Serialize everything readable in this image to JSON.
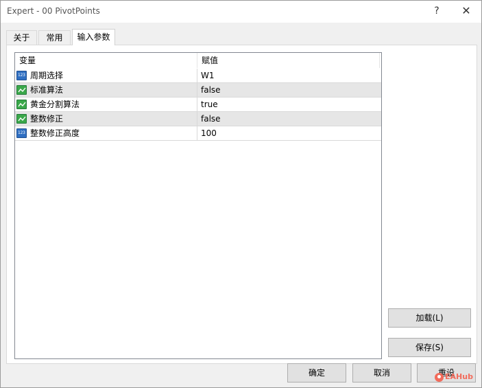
{
  "window": {
    "title": "Expert - 00 PivotPoints",
    "help_glyph": "?",
    "close_glyph": "✕"
  },
  "tabs": [
    {
      "label": "关于",
      "active": false
    },
    {
      "label": "常用",
      "active": false
    },
    {
      "label": "输入参数",
      "active": true
    }
  ],
  "grid": {
    "headers": [
      "变量",
      "赋值"
    ],
    "rows": [
      {
        "name": "周期选择",
        "value": "W1",
        "icon": "number-icon"
      },
      {
        "name": "标准算法",
        "value": "false",
        "icon": "boolean-icon"
      },
      {
        "name": "黄金分割算法",
        "value": "true",
        "icon": "boolean-icon"
      },
      {
        "name": "整数修正",
        "value": "false",
        "icon": "boolean-icon"
      },
      {
        "name": "整数修正高度",
        "value": "100",
        "icon": "number-icon"
      }
    ]
  },
  "buttons": {
    "load": "加载(L)",
    "save": "保存(S)",
    "ok": "确定",
    "cancel": "取消",
    "reset": "重设"
  },
  "watermark": {
    "text": "EAHub"
  },
  "colors": {
    "alt_row": "#e6e6e6",
    "number_icon": "#2f6fc2",
    "boolean_icon": "#3aa84a",
    "watermark": "#f26b5b"
  }
}
